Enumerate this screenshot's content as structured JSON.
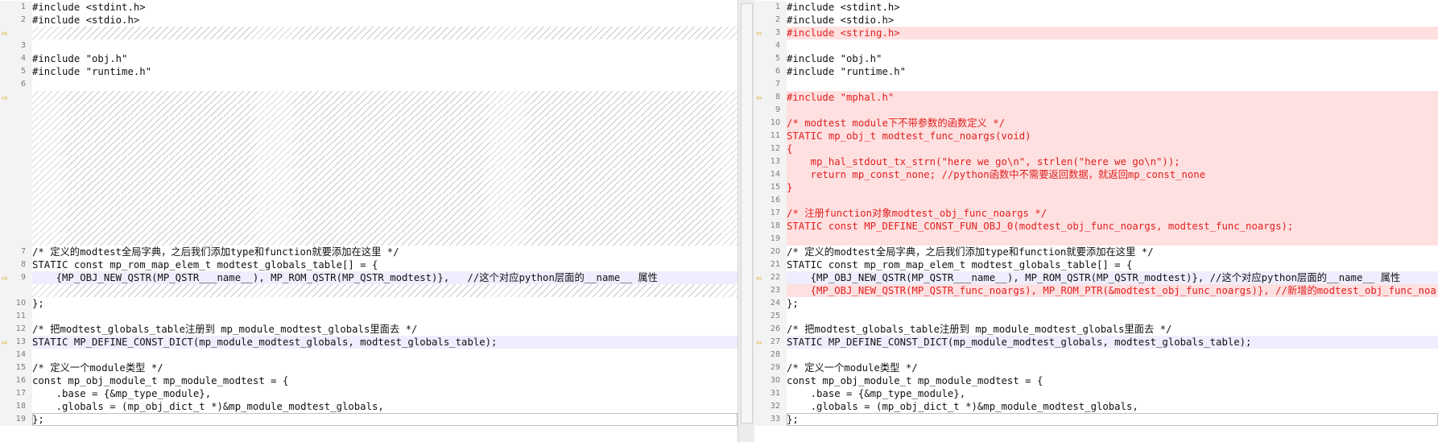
{
  "colors": {
    "added_background": "#ffe0e0",
    "added_text": "#e02020",
    "changed_background": "#eeeeff",
    "arrow": "#d9a400"
  },
  "left": {
    "lines": [
      {
        "n": "1",
        "text": "#include <stdint.h>",
        "kind": "normal"
      },
      {
        "n": "2",
        "text": "#include <stdio.h>",
        "kind": "normal"
      },
      {
        "n": "",
        "text": "",
        "kind": "placeholder",
        "arrow": true
      },
      {
        "n": "3",
        "text": "",
        "kind": "normal"
      },
      {
        "n": "4",
        "text": "#include \"obj.h\"",
        "kind": "normal"
      },
      {
        "n": "5",
        "text": "#include \"runtime.h\"",
        "kind": "normal"
      },
      {
        "n": "6",
        "text": "",
        "kind": "normal"
      },
      {
        "n": "",
        "text": "",
        "kind": "placeholder",
        "arrow": true
      },
      {
        "n": "",
        "text": "",
        "kind": "placeholder"
      },
      {
        "n": "",
        "text": "",
        "kind": "placeholder"
      },
      {
        "n": "",
        "text": "",
        "kind": "placeholder"
      },
      {
        "n": "",
        "text": "",
        "kind": "placeholder"
      },
      {
        "n": "",
        "text": "",
        "kind": "placeholder"
      },
      {
        "n": "",
        "text": "",
        "kind": "placeholder"
      },
      {
        "n": "",
        "text": "",
        "kind": "placeholder"
      },
      {
        "n": "",
        "text": "",
        "kind": "placeholder"
      },
      {
        "n": "",
        "text": "",
        "kind": "placeholder"
      },
      {
        "n": "",
        "text": "",
        "kind": "placeholder"
      },
      {
        "n": "",
        "text": "",
        "kind": "placeholder"
      },
      {
        "n": "7",
        "text": "/* 定义的modtest全局字典，之后我们添加type和function就要添加在这里 */",
        "kind": "normal"
      },
      {
        "n": "8",
        "text": "STATIC const mp_rom_map_elem_t modtest_globals_table[] = {",
        "kind": "normal"
      },
      {
        "n": "9",
        "text": "    {MP_OBJ_NEW_QSTR(MP_QSTR___name__), MP_ROM_QSTR(MP_QSTR_modtest)},   //这个对应python层面的__name__ 属性",
        "kind": "changed",
        "arrow": true
      },
      {
        "n": "",
        "text": "",
        "kind": "placeholder"
      },
      {
        "n": "10",
        "text": "};",
        "kind": "normal"
      },
      {
        "n": "11",
        "text": "",
        "kind": "normal"
      },
      {
        "n": "12",
        "text": "/* 把modtest_globals_table注册到 mp_module_modtest_globals里面去 */",
        "kind": "normal"
      },
      {
        "n": "13",
        "text": "STATIC MP_DEFINE_CONST_DICT(mp_module_modtest_globals, modtest_globals_table);",
        "kind": "changed",
        "arrow": true
      },
      {
        "n": "14",
        "text": "",
        "kind": "normal"
      },
      {
        "n": "15",
        "text": "/* 定义一个module类型 */",
        "kind": "normal"
      },
      {
        "n": "16",
        "text": "const mp_obj_module_t mp_module_modtest = {",
        "kind": "normal"
      },
      {
        "n": "17",
        "text": "    .base = {&mp_type_module},",
        "kind": "normal"
      },
      {
        "n": "18",
        "text": "    .globals = (mp_obj_dict_t *)&mp_module_modtest_globals,",
        "kind": "normal"
      },
      {
        "n": "19",
        "text": "};",
        "kind": "current"
      }
    ]
  },
  "right": {
    "lines": [
      {
        "n": "1",
        "text": "#include <stdint.h>",
        "kind": "normal"
      },
      {
        "n": "2",
        "text": "#include <stdio.h>",
        "kind": "normal"
      },
      {
        "n": "3",
        "text": "#include <string.h>",
        "kind": "added",
        "arrow": true
      },
      {
        "n": "4",
        "text": "",
        "kind": "normal"
      },
      {
        "n": "5",
        "text": "#include \"obj.h\"",
        "kind": "normal"
      },
      {
        "n": "6",
        "text": "#include \"runtime.h\"",
        "kind": "normal"
      },
      {
        "n": "7",
        "text": "",
        "kind": "normal"
      },
      {
        "n": "8",
        "text": "#include \"mphal.h\"",
        "kind": "added",
        "arrow": true
      },
      {
        "n": "9",
        "text": "",
        "kind": "added"
      },
      {
        "n": "10",
        "text": "/* modtest module下不带参数的函数定义 */",
        "kind": "added"
      },
      {
        "n": "11",
        "text": "STATIC mp_obj_t modtest_func_noargs(void)",
        "kind": "added"
      },
      {
        "n": "12",
        "text": "{",
        "kind": "added"
      },
      {
        "n": "13",
        "text": "    mp_hal_stdout_tx_strn(\"here we go\\n\", strlen(\"here we go\\n\"));",
        "kind": "added"
      },
      {
        "n": "14",
        "text": "    return mp_const_none; //python函数中不需要返回数据，就返回mp_const_none",
        "kind": "added"
      },
      {
        "n": "15",
        "text": "}",
        "kind": "added"
      },
      {
        "n": "16",
        "text": "",
        "kind": "added"
      },
      {
        "n": "17",
        "text": "/* 注册function对象modtest_obj_func_noargs */",
        "kind": "added"
      },
      {
        "n": "18",
        "text": "STATIC const MP_DEFINE_CONST_FUN_OBJ_0(modtest_obj_func_noargs, modtest_func_noargs);",
        "kind": "added"
      },
      {
        "n": "19",
        "text": "",
        "kind": "added"
      },
      {
        "n": "20",
        "text": "/* 定义的modtest全局字典，之后我们添加type和function就要添加在这里 */",
        "kind": "normal"
      },
      {
        "n": "21",
        "text": "STATIC const mp_rom_map_elem_t modtest_globals_table[] = {",
        "kind": "normal"
      },
      {
        "n": "22",
        "text": "    {MP_OBJ_NEW_QSTR(MP_QSTR___name__), MP_ROM_QSTR(MP_QSTR_modtest)}, //这个对应python层面的__name__ 属性",
        "kind": "changed",
        "arrow": true
      },
      {
        "n": "23",
        "text": "    {MP_OBJ_NEW_QSTR(MP_QSTR_func_noargs), MP_ROM_PTR(&modtest_obj_func_noargs)}, //新增的modtest_obj_func_noargs对",
        "kind": "added"
      },
      {
        "n": "24",
        "text": "};",
        "kind": "normal"
      },
      {
        "n": "25",
        "text": "",
        "kind": "normal"
      },
      {
        "n": "26",
        "text": "/* 把modtest_globals_table注册到 mp_module_modtest_globals里面去 */",
        "kind": "normal"
      },
      {
        "n": "27",
        "text": "STATIC MP_DEFINE_CONST_DICT(mp_module_modtest_globals, modtest_globals_table);",
        "kind": "changed",
        "arrow": true
      },
      {
        "n": "28",
        "text": "",
        "kind": "normal"
      },
      {
        "n": "29",
        "text": "/* 定义一个module类型 */",
        "kind": "normal"
      },
      {
        "n": "30",
        "text": "const mp_obj_module_t mp_module_modtest = {",
        "kind": "normal"
      },
      {
        "n": "31",
        "text": "    .base = {&mp_type_module},",
        "kind": "normal"
      },
      {
        "n": "32",
        "text": "    .globals = (mp_obj_dict_t *)&mp_module_modtest_globals,",
        "kind": "normal"
      },
      {
        "n": "33",
        "text": "};",
        "kind": "current"
      }
    ]
  }
}
